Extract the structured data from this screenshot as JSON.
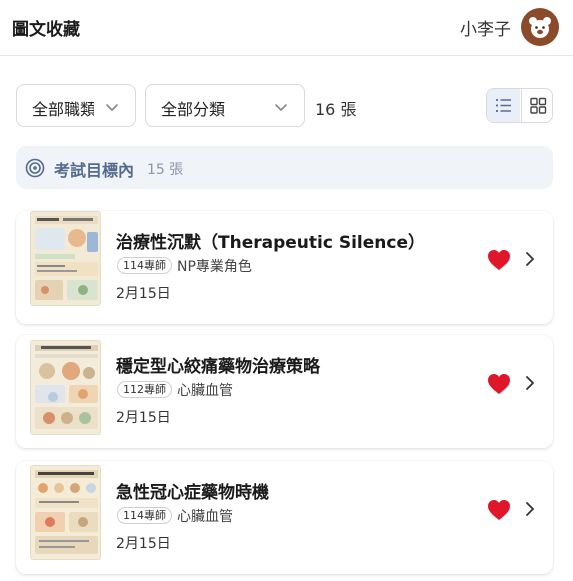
{
  "header": {
    "title": "圖文收藏",
    "username": "小李子"
  },
  "filters": {
    "profession_label": "全部職類",
    "category_label": "全部分類",
    "count_text": "16 張"
  },
  "view_toggle": {
    "selected": "list"
  },
  "section": {
    "title": "考試目標內",
    "count": "15 張"
  },
  "cards": [
    {
      "title": "治療性沉默（Therapeutic Silence）",
      "badge": "114專師",
      "category": "NP專業角色",
      "date": "2月15日"
    },
    {
      "title": "穩定型心絞痛藥物治療策略",
      "badge": "112專師",
      "category": "心臟血管",
      "date": "2月15日"
    },
    {
      "title": "急性冠心症藥物時機",
      "badge": "114專師",
      "category": "心臟血管",
      "date": "2月15日"
    }
  ],
  "colors": {
    "accent_heart": "#e0162b",
    "section_text": "#536a8f",
    "avatar": "#8b4a2a"
  }
}
